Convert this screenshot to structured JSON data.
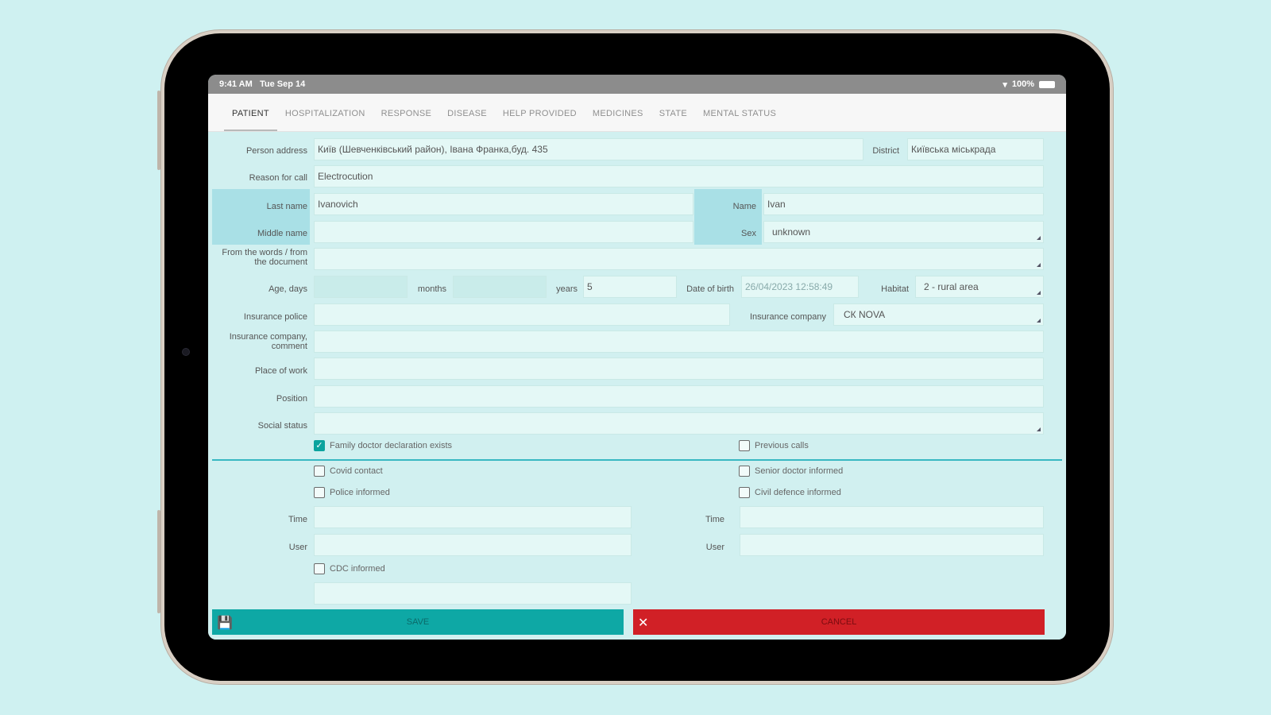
{
  "status_bar": {
    "time": "9:41 AM",
    "date": "Tue Sep 14",
    "battery": "100%"
  },
  "tabs": [
    "PATIENT",
    "HOSPITALIZATION",
    "RESPONSE",
    "DISEASE",
    "HELP PROVIDED",
    "MEDICINES",
    "STATE",
    "MENTAL STATUS"
  ],
  "form": {
    "person_address_label": "Person address",
    "person_address_value": "Київ (Шевченківський район), Івана Франка,буд. 435",
    "district_label": "District",
    "district_value": "Київська міськрада",
    "reason_label": "Reason for call",
    "reason_value": "Electrocution",
    "last_name_label": "Last name",
    "last_name_value": "Ivanovich",
    "name_label": "Name",
    "name_value": "Ivan",
    "middle_name_label": "Middle name",
    "sex_label": "Sex",
    "sex_value": "unknown",
    "from_words_label": "From the words / from the document",
    "age_days_label": "Age, days",
    "months_label": "months",
    "years_label": "years",
    "years_value": "5",
    "dob_label": "Date of birth",
    "dob_value": "26/04/2023 12:58:49",
    "habitat_label": "Habitat",
    "habitat_value": "2 - rural area",
    "insurance_police_label": "Insurance police",
    "insurance_company_label": "Insurance company",
    "insurance_company_value": "СК NOVA",
    "insurance_comment_label": "Insurance company, comment",
    "place_of_work_label": "Place of work",
    "position_label": "Position",
    "social_status_label": "Social status",
    "family_doctor_label": "Family doctor declaration exists",
    "previous_calls_label": "Previous calls",
    "covid_contact_label": "Covid contact",
    "senior_doctor_label": "Senior doctor informed",
    "police_informed_label": "Police informed",
    "civil_defence_label": "Civil defence informed",
    "time_label": "Time",
    "user_label": "User",
    "cdc_informed_label": "CDC informed"
  },
  "buttons": {
    "save": "SAVE",
    "cancel": "CANCEL"
  },
  "colors": {
    "accent": "#0ea8a5",
    "cancel": "#d12026",
    "background": "#cff1f1"
  }
}
